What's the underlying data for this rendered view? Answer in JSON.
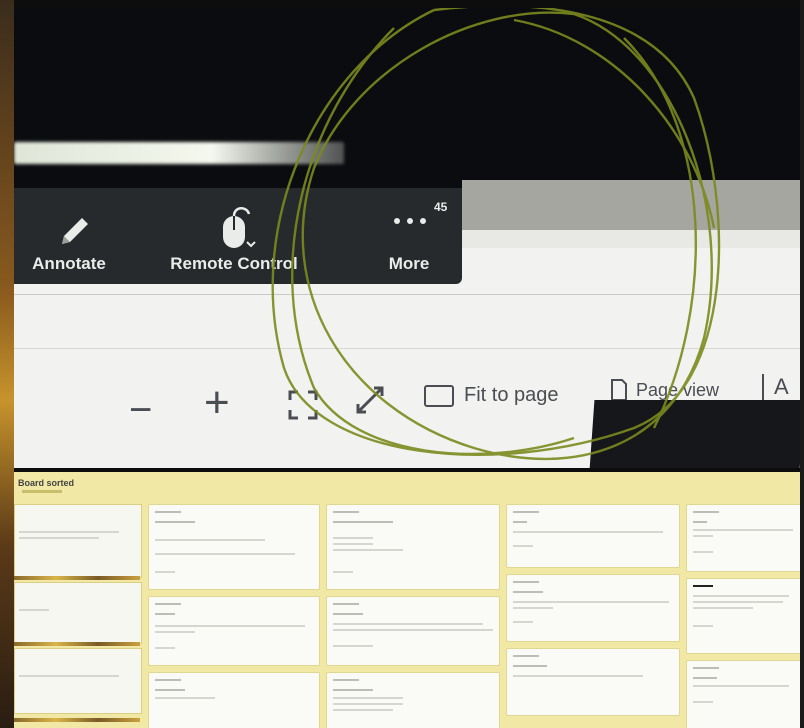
{
  "toolbar": {
    "annotate_label": "Annotate",
    "remote_control_label": "Remote Control",
    "more_label": "More",
    "badge": "45"
  },
  "viewer": {
    "zoom_out": "−",
    "zoom_in": "+",
    "fit_to_page": "Fit to page",
    "page_view": "Page view",
    "overflow_text": "A"
  },
  "board": {
    "title": "Board sorted"
  },
  "icons": [
    "pencil-icon",
    "mouse-icon",
    "ellipsis-icon",
    "zoom-out-icon",
    "zoom-in-icon",
    "fullscreen-icon",
    "expand-icon",
    "fit-page-icon",
    "page-view-icon"
  ],
  "colors": {
    "toolbar_bg": "#262a2c",
    "annotation_stroke": "#7c8a1e",
    "board_bg": "#f0e8a4"
  }
}
